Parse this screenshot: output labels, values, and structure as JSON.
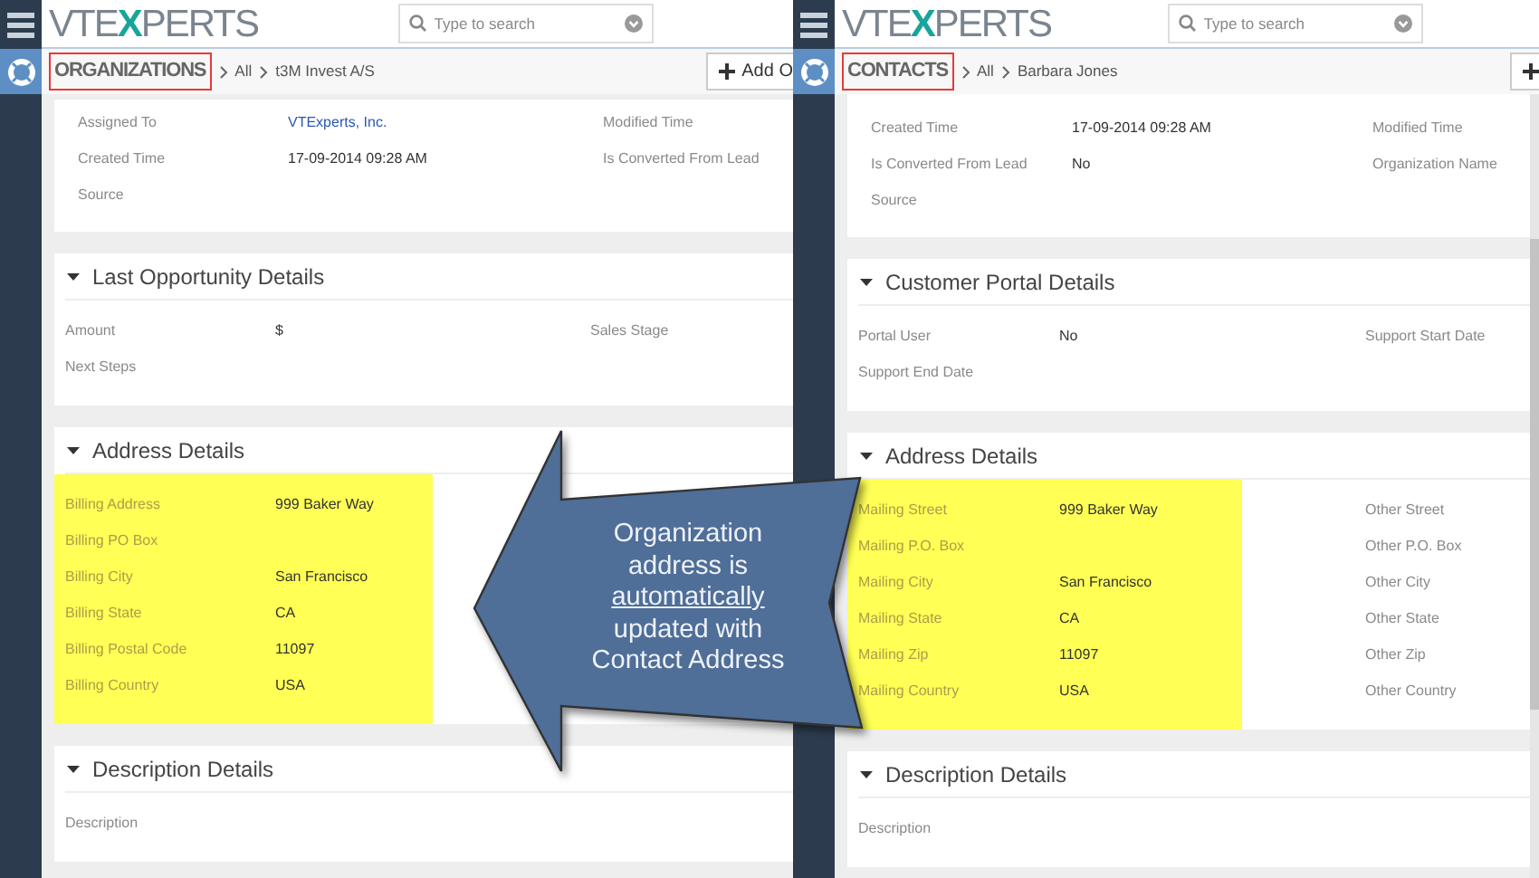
{
  "panels": [
    {
      "logo": [
        "VTE",
        "X",
        "PERTS"
      ],
      "search": {
        "placeholder": "Type to search"
      },
      "module": {
        "label": "ORGANIZATIONS",
        "highlighted": true
      },
      "breadcrumb": [
        "All",
        "t3M Invest A/S"
      ],
      "action_button": "Add O",
      "top_fields": [
        {
          "label": "Assigned To",
          "value": "VTExperts, Inc.",
          "kind": "link",
          "label_2": "Modified Time"
        },
        {
          "label": "Created Time",
          "value": "17-09-2014 09:28 AM",
          "kind": "text",
          "label_2": "Is Converted From Lead"
        },
        {
          "label": "Source",
          "kind": "text"
        }
      ],
      "sections": [
        {
          "title": "Last Opportunity Details",
          "highlighted": false,
          "fields": [
            {
              "label": "Amount",
              "value": "$",
              "label_2": "Sales Stage"
            },
            {
              "label": "Next Steps"
            }
          ]
        },
        {
          "title": "Address Details",
          "highlighted": true,
          "fields": [
            {
              "label": "Billing Address",
              "value": "999 Baker Way"
            },
            {
              "label": "Billing PO Box"
            },
            {
              "label": "Billing City",
              "value": "San Francisco"
            },
            {
              "label": "Billing State",
              "value": "CA"
            },
            {
              "label": "Billing Postal Code",
              "value": "11097"
            },
            {
              "label": "Billing Country",
              "value": "USA"
            }
          ]
        },
        {
          "title": "Description Details",
          "highlighted": false,
          "fields": [
            {
              "label": "Description"
            }
          ]
        }
      ]
    },
    {
      "logo": [
        "VTE",
        "X",
        "PERTS"
      ],
      "search": {
        "placeholder": "Type to search"
      },
      "module": {
        "label": "CONTACTS",
        "highlighted": true
      },
      "breadcrumb": [
        "All",
        "Barbara Jones"
      ],
      "top_fields": [
        {
          "label": "Created Time",
          "value": "17-09-2014 09:28 AM",
          "kind": "text",
          "label_2": "Modified Time"
        },
        {
          "label": "Is Converted From Lead",
          "value": "No",
          "kind": "text",
          "label_2": "Organization Name"
        },
        {
          "label": "Source",
          "kind": "text"
        }
      ],
      "sections": [
        {
          "title": "Customer Portal Details",
          "highlighted": false,
          "fields": [
            {
              "label": "Portal User",
              "value": "No",
              "label_2": "Support Start Date"
            },
            {
              "label": "Support End Date"
            }
          ]
        },
        {
          "title": "Address Details",
          "highlighted": true,
          "fields": [
            {
              "label": "Mailing Street",
              "value": "999 Baker Way",
              "label_2": "Other Street"
            },
            {
              "label": "Mailing P.O. Box",
              "label_2": "Other P.O. Box"
            },
            {
              "label": "Mailing City",
              "value": "San Francisco",
              "label_2": "Other City"
            },
            {
              "label": "Mailing State",
              "value": "CA",
              "label_2": "Other State"
            },
            {
              "label": "Mailing Zip",
              "value": "11097",
              "label_2": "Other Zip"
            },
            {
              "label": "Mailing Country",
              "value": "USA",
              "label_2": "Other Country"
            }
          ]
        },
        {
          "title": "Description Details",
          "highlighted": false,
          "fields": [
            {
              "label": "Description"
            }
          ]
        }
      ]
    }
  ],
  "callout": {
    "before": "Organization address is",
    "underlined": "automatically",
    "after": "updated with Contact Address"
  }
}
